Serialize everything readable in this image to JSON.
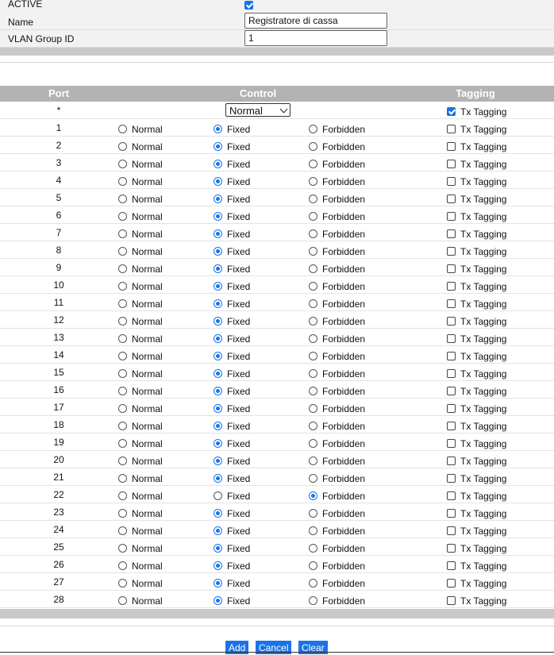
{
  "form": {
    "active_label": "ACTIVE",
    "active_checked": true,
    "name_label": "Name",
    "name_value": "Registratore di cassa",
    "vlan_label": "VLAN Group ID",
    "vlan_value": "1"
  },
  "table": {
    "headers": {
      "port": "Port",
      "control": "Control",
      "tagging": "Tagging"
    },
    "all_row": {
      "port": "*",
      "select_value": "Normal",
      "tagging_label": "Tx Tagging",
      "tagging_checked": true
    },
    "labels": {
      "normal": "Normal",
      "fixed": "Fixed",
      "forbidden": "Forbidden",
      "tagging": "Tx Tagging"
    },
    "rows": [
      {
        "port": "1",
        "control": "Fixed",
        "tagging": false
      },
      {
        "port": "2",
        "control": "Fixed",
        "tagging": false
      },
      {
        "port": "3",
        "control": "Fixed",
        "tagging": false
      },
      {
        "port": "4",
        "control": "Fixed",
        "tagging": false
      },
      {
        "port": "5",
        "control": "Fixed",
        "tagging": false
      },
      {
        "port": "6",
        "control": "Fixed",
        "tagging": false
      },
      {
        "port": "7",
        "control": "Fixed",
        "tagging": false
      },
      {
        "port": "8",
        "control": "Fixed",
        "tagging": false
      },
      {
        "port": "9",
        "control": "Fixed",
        "tagging": false
      },
      {
        "port": "10",
        "control": "Fixed",
        "tagging": false
      },
      {
        "port": "11",
        "control": "Fixed",
        "tagging": false
      },
      {
        "port": "12",
        "control": "Fixed",
        "tagging": false
      },
      {
        "port": "13",
        "control": "Fixed",
        "tagging": false
      },
      {
        "port": "14",
        "control": "Fixed",
        "tagging": false
      },
      {
        "port": "15",
        "control": "Fixed",
        "tagging": false
      },
      {
        "port": "16",
        "control": "Fixed",
        "tagging": false
      },
      {
        "port": "17",
        "control": "Fixed",
        "tagging": false
      },
      {
        "port": "18",
        "control": "Fixed",
        "tagging": false
      },
      {
        "port": "19",
        "control": "Fixed",
        "tagging": false
      },
      {
        "port": "20",
        "control": "Fixed",
        "tagging": false
      },
      {
        "port": "21",
        "control": "Fixed",
        "tagging": false
      },
      {
        "port": "22",
        "control": "Forbidden",
        "tagging": false
      },
      {
        "port": "23",
        "control": "Fixed",
        "tagging": false
      },
      {
        "port": "24",
        "control": "Fixed",
        "tagging": false
      },
      {
        "port": "25",
        "control": "Fixed",
        "tagging": false
      },
      {
        "port": "26",
        "control": "Fixed",
        "tagging": false
      },
      {
        "port": "27",
        "control": "Fixed",
        "tagging": false
      },
      {
        "port": "28",
        "control": "Fixed",
        "tagging": false
      }
    ]
  },
  "buttons": {
    "add": "Add",
    "cancel": "Cancel",
    "clear": "Clear"
  },
  "colors": {
    "accent": "#1a73e8",
    "header_bg": "#b3b3b3",
    "bar_gray": "#c8c8c8",
    "form_row_bg": "#f2f2f2"
  }
}
